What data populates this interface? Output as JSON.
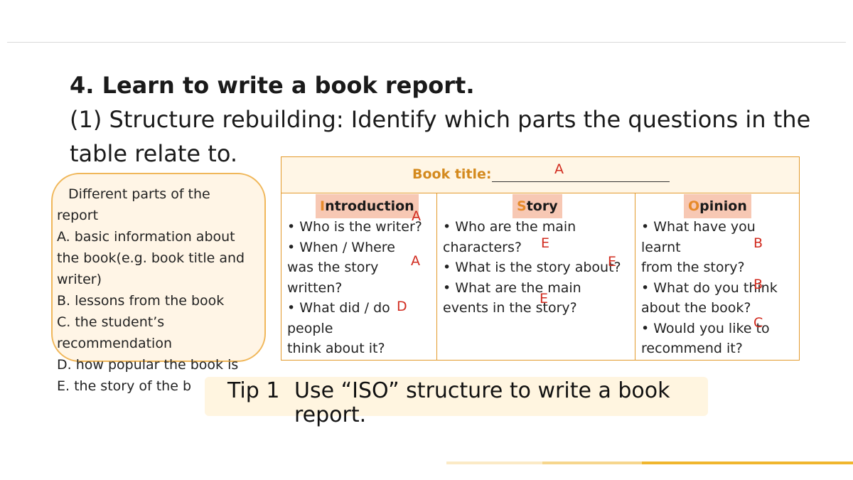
{
  "heading": {
    "line1": "4. Learn to write a book report.",
    "line2": "(1) Structure rebuilding: Identify which parts the questions in the",
    "line3": "table relate to."
  },
  "parts": {
    "title": "Different parts of the",
    "title2": "report",
    "items": [
      "A. basic information about",
      "the book(e.g. book title and",
      "writer)",
      "B. lessons from the book",
      "C. the student’s",
      "recommendation",
      "D. how popular the book is",
      "E. the story of the b"
    ]
  },
  "table": {
    "book_title_label": "Book title:",
    "book_title_answer": "A",
    "columns": [
      {
        "header_first": "I",
        "header_rest": "ntroduction",
        "lines": [
          "• Who is the writer?",
          "• When / Where",
          "was the  story",
          "written?",
          "• What did / do",
          "people",
          "   think about it?"
        ]
      },
      {
        "header_first": "S",
        "header_rest": "tory",
        "lines": [
          "• Who are the main",
          "characters?",
          "• What is the story about?",
          "• What are the main",
          "events in the story?"
        ]
      },
      {
        "header_first": "O",
        "header_rest": "pinion",
        "lines": [
          "• What have you",
          "learnt",
          "   from the story?",
          "• What do you think",
          "about  the book?",
          "• Would you like to",
          "   recommend it?"
        ]
      }
    ],
    "answers": {
      "intro_writer": "A",
      "intro_where": "A",
      "intro_people": "D",
      "story_characters": "E",
      "story_about": "E",
      "story_events": "E",
      "opinion_learnt": "B",
      "opinion_think": "B",
      "opinion_recommend": "C"
    }
  },
  "tip": {
    "label": "Tip 1",
    "text_line1": "Use “ISO” structure to write a book",
    "text_line2": "report."
  },
  "colors": {
    "accent": "#e39a2c",
    "answer_red": "#d12b1f",
    "header_fill": "#f7c8b4",
    "tip_bg": "#fff5e0"
  }
}
